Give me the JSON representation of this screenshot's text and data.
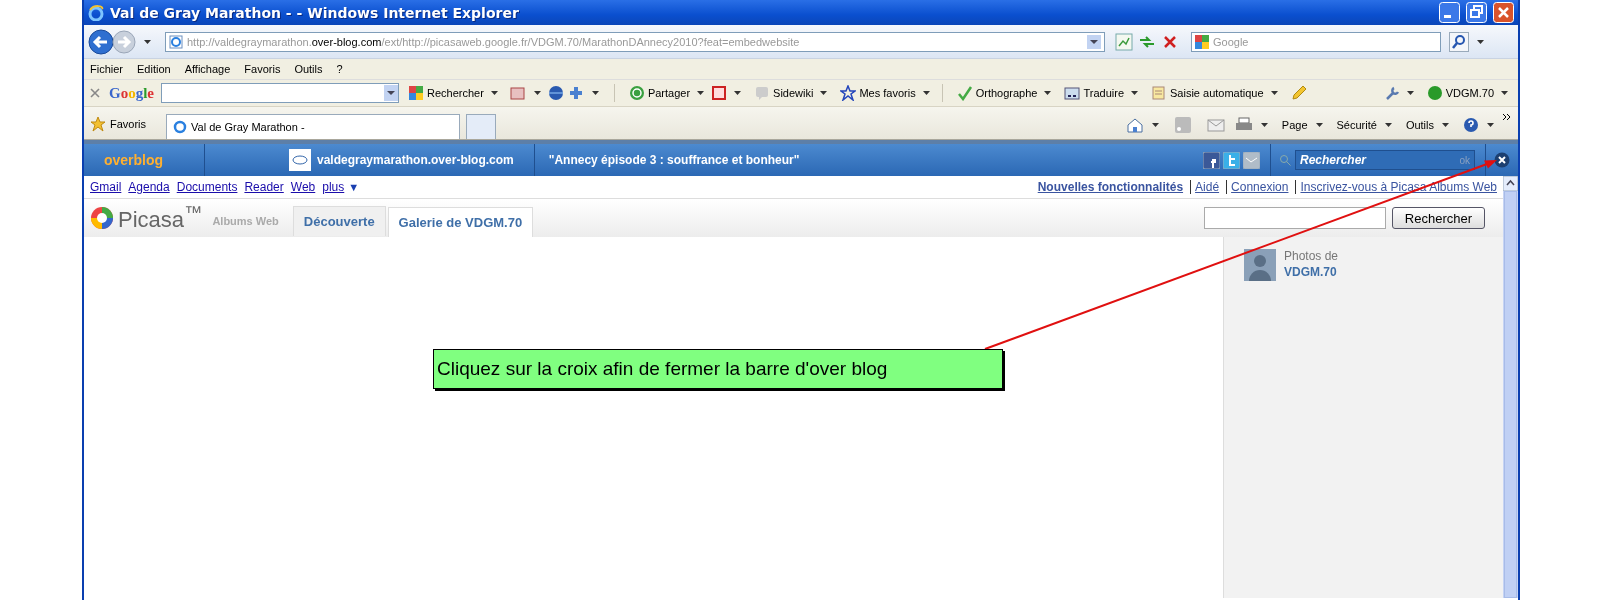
{
  "window": {
    "title": "Val de Gray Marathon - - Windows Internet Explorer"
  },
  "address_bar": {
    "url_start": "http://valdegraymarathon.",
    "url_domain": "over-blog.com",
    "url_end": "/ext/http://picasaweb.google.fr/VDGM.70/MarathonDAnnecy2010?feat=embedwebsite",
    "search_placeholder": "Google"
  },
  "menu": [
    "Fichier",
    "Edition",
    "Affichage",
    "Favoris",
    "Outils",
    "?"
  ],
  "google_toolbar": {
    "logo": "Google",
    "items": [
      "Rechercher",
      "Partager",
      "Sidewiki",
      "Mes favoris",
      "Orthographe",
      "Traduire",
      "Saisie automatique"
    ],
    "account": "VDGM.70"
  },
  "favorites": "Favoris",
  "tabs": [
    {
      "label": "Val de Gray Marathon -",
      "selected": true
    }
  ],
  "command_bar": [
    "Page",
    "Sécurité",
    "Outils"
  ],
  "overblog_bar": {
    "logo": "overblog",
    "blog": "valdegraymarathon.over-blog.com",
    "article": "\"Annecy épisode 3 : souffrance et bonheur\"",
    "search_placeholder": "Rechercher",
    "ok": "ok"
  },
  "google_links": [
    "Gmail",
    "Agenda",
    "Documents",
    "Reader",
    "Web",
    "plus"
  ],
  "more_arrow": "▼",
  "account_links": [
    {
      "label": "Nouvelles fonctionnalités",
      "bold": true
    },
    {
      "label": "Aidé",
      "bold": false
    },
    {
      "label": "Connexion",
      "bold": false
    },
    {
      "label": "Inscrivez-vous à Picasa Albums Web",
      "bold": false
    }
  ],
  "picasa": {
    "logo": "Picasa$^{™}$",
    "subtitle": "Albums Web",
    "tabs": [
      {
        "label": "Découverte",
        "selected": false
      },
      {
        "label": "Galerie de VDGM.70",
        "selected": true
      }
    ],
    "search_button": "Rechercher",
    "owner_caption": "Photos de",
    "owner_name": "VDGM.70"
  },
  "annotation": "Cliquez sur la croix afin de fermer la barre d'over blog"
}
